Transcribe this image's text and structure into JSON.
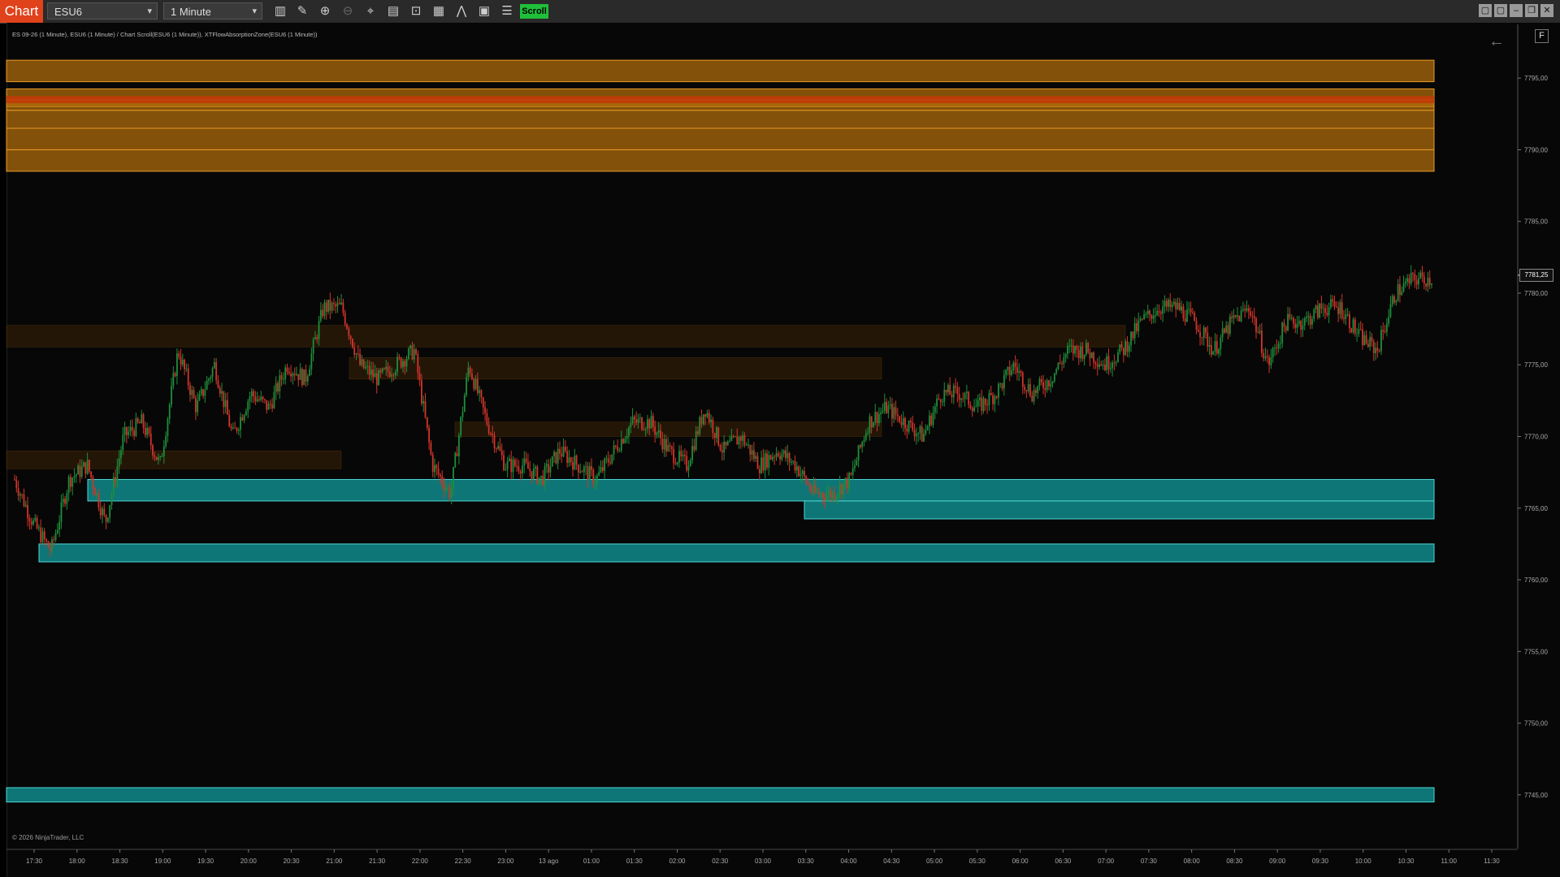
{
  "toolbar": {
    "chart_tab": "Chart",
    "instrument": "ESU6",
    "interval": "1 Minute",
    "scroll_label": "Scroll",
    "icons": [
      "bar-type-icon",
      "draw-tool-icon",
      "zoom-in-icon",
      "zoom-out-icon",
      "crosshair-icon",
      "data-box-icon",
      "strategy-icon",
      "indicator-icon",
      "bar-chart-icon",
      "properties-icon",
      "list-icon"
    ],
    "window_buttons": [
      "tile-icon",
      "restore-left-icon",
      "minimize-icon",
      "maximize-icon",
      "close-icon"
    ]
  },
  "chart_header": "ES 09-26 (1 Minute), ESU6 (1 Minute) / Chart Scroll(ESU6 (1 Minute)), XTFlowAbsorptionZone(ESU6 (1 Minute))",
  "copyright": "© 2026 NinjaTrader, LLC",
  "f_button": "F",
  "colors": {
    "background": "#070707",
    "bullish": "#1e8f3a",
    "bearish": "#d2342a",
    "supply_zone": "#b8700a",
    "supply_core": "#c13a08",
    "demand_zone": "#0f8a8a",
    "demand_border": "#4fd6d6",
    "faint_zone": "#3a2308"
  },
  "chart_data": {
    "type": "candlestick",
    "symbol": "ESU6",
    "interval": "1 Minute",
    "last_price": 7781.25,
    "last_price_label": "7781,25",
    "y_ticks": [
      7795,
      7790,
      7785,
      7780,
      7775,
      7770,
      7765,
      7760,
      7755,
      7750,
      7745
    ],
    "y_tick_labels": [
      "7795,00",
      "7790,00",
      "7785,00",
      "7780,00",
      "7775,00",
      "7770,00",
      "7765,00",
      "7760,00",
      "7755,00",
      "7750,00",
      "7745,00"
    ],
    "ylim": [
      7741.25,
      7798.75
    ],
    "x_tick_labels": [
      "17:30",
      "18:00",
      "18:30",
      "19:00",
      "19:30",
      "20:00",
      "20:30",
      "21:00",
      "21:30",
      "22:00",
      "22:30",
      "23:00",
      "13 ago",
      "01:00",
      "01:30",
      "02:00",
      "02:30",
      "03:00",
      "03:30",
      "04:00",
      "04:30",
      "05:00",
      "05:30",
      "06:00",
      "06:30",
      "07:00",
      "07:30",
      "08:00",
      "08:30",
      "09:00",
      "09:30",
      "10:00",
      "10:30",
      "11:00",
      "11:30"
    ],
    "series": [
      {
        "price_path": [
          [
            0,
            7767
          ],
          [
            1,
            7764
          ],
          [
            2,
            7762
          ],
          [
            3,
            7767
          ],
          [
            4,
            7768
          ],
          [
            5,
            7764
          ],
          [
            6,
            7770
          ],
          [
            7,
            7771
          ],
          [
            8,
            7768
          ],
          [
            9,
            7776
          ],
          [
            10,
            7772
          ],
          [
            11,
            7775
          ],
          [
            12,
            7770
          ],
          [
            13,
            7773
          ],
          [
            14,
            7772
          ],
          [
            15,
            7775
          ],
          [
            16,
            7774
          ],
          [
            17,
            7779
          ],
          [
            18,
            7779
          ],
          [
            19,
            7775
          ],
          [
            20,
            7774
          ],
          [
            21,
            7775
          ],
          [
            22,
            7776
          ],
          [
            23,
            7768
          ],
          [
            24,
            7766
          ],
          [
            25,
            7775
          ],
          [
            26,
            7771
          ],
          [
            27,
            7768
          ],
          [
            28,
            7768
          ],
          [
            29,
            7767
          ],
          [
            30,
            7769
          ],
          [
            31,
            7768
          ],
          [
            32,
            7767
          ],
          [
            33,
            7769
          ],
          [
            34,
            7771
          ],
          [
            35,
            7771
          ],
          [
            36,
            7769
          ],
          [
            37,
            7768
          ],
          [
            38,
            7772
          ],
          [
            39,
            7769
          ],
          [
            40,
            7770
          ],
          [
            41,
            7768
          ],
          [
            42,
            7769
          ],
          [
            43,
            7768
          ],
          [
            44,
            7766
          ],
          [
            45,
            7766
          ],
          [
            46,
            7767
          ],
          [
            47,
            7771
          ],
          [
            48,
            7772
          ],
          [
            49,
            7771
          ],
          [
            50,
            7770
          ],
          [
            51,
            7773
          ],
          [
            52,
            7773
          ],
          [
            53,
            7772
          ],
          [
            54,
            7773
          ],
          [
            55,
            7775
          ],
          [
            56,
            7773
          ],
          [
            57,
            7774
          ],
          [
            58,
            7776
          ],
          [
            59,
            7776
          ],
          [
            60,
            7775
          ],
          [
            61,
            7776
          ],
          [
            62,
            7778
          ],
          [
            63,
            7779
          ],
          [
            64,
            7779
          ],
          [
            65,
            7778
          ],
          [
            66,
            7776
          ],
          [
            67,
            7778
          ],
          [
            68,
            7779
          ],
          [
            69,
            7775
          ],
          [
            70,
            7778
          ],
          [
            71,
            7778
          ],
          [
            72,
            7779
          ],
          [
            73,
            7779
          ],
          [
            74,
            7777
          ],
          [
            75,
            7776
          ],
          [
            76,
            7780
          ],
          [
            77,
            7781
          ],
          [
            78,
            7781
          ]
        ]
      }
    ],
    "zones": {
      "supply": [
        [
          7796.25,
          7794.75
        ],
        [
          7794.25,
          7793.0
        ],
        [
          7793.5,
          7792.75
        ],
        [
          7792.75,
          7791.5
        ],
        [
          7791.5,
          7790.0
        ],
        [
          7790.0,
          7788.5
        ]
      ],
      "supply_core": [
        [
          7793.75,
          7793.25
        ]
      ],
      "demand": [
        [
          7767.0,
          7765.5
        ],
        [
          7765.5,
          7764.25
        ],
        [
          7762.5,
          7761.25
        ],
        [
          7745.5,
          7744.5
        ]
      ],
      "faint": [
        [
          7777.75,
          7776.25
        ],
        [
          7775.5,
          7774.0
        ],
        [
          7771.0,
          7770.0
        ],
        [
          7769.0,
          7767.75
        ]
      ]
    },
    "grid": false,
    "legend": "none"
  }
}
